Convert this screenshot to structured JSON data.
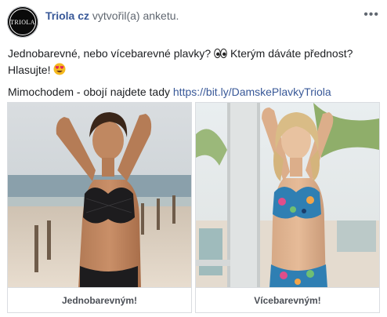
{
  "post": {
    "page_name": "Triola cz",
    "action_text": "vytvořil(a) anketu.",
    "avatar_text": "TRIOLA",
    "more_glyph": "•••",
    "line1": "Jednobarevné, nebo vícebarevné plavky?",
    "line1_rest": "Kterým dáváte přednost?",
    "line2": "Hlasujte!",
    "line3": "Mimochodem - obojí najdete tady",
    "link": "https://bit.ly/DamskePlavkyTriola"
  },
  "poll": {
    "options": [
      {
        "label": "Jednobarevným!",
        "image": "black-lace-bikini-photo"
      },
      {
        "label": "Vícebarevným!",
        "image": "floral-print-bikini-photo"
      }
    ]
  },
  "colors": {
    "link": "#385898",
    "text": "#1c1e21",
    "meta": "#606770",
    "border": "#dadde1"
  },
  "icons": [
    "eyes-emoji",
    "heart-eyes-emoji",
    "more-options-icon"
  ]
}
